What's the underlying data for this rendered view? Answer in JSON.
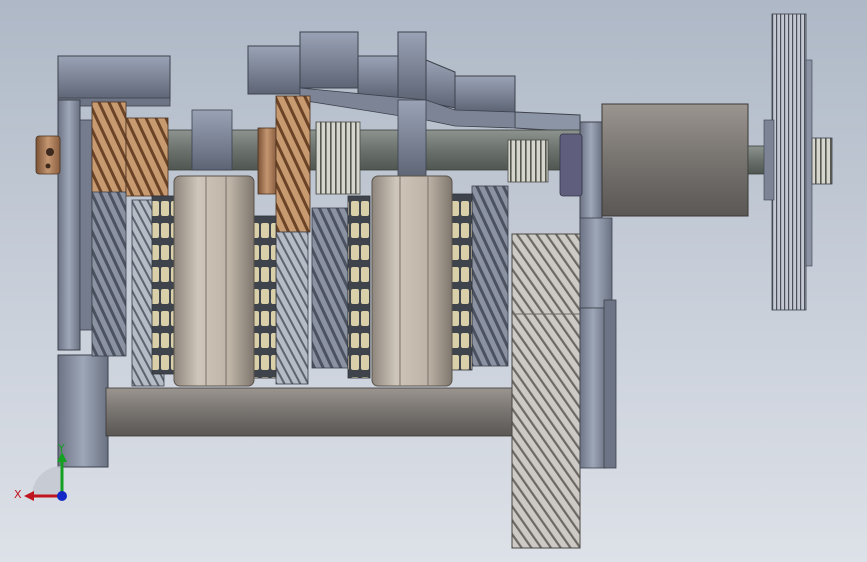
{
  "viewport": {
    "background_top": "#aeb8c6",
    "background_bottom": "#dde1e8",
    "model": "gearbox-assembly"
  },
  "triad": {
    "x_label": "X",
    "y_label": "Y",
    "x_color": "#c0141e",
    "y_color": "#14a020",
    "z_color": "#1428c8"
  },
  "colors": {
    "housing": "#8a93a6",
    "housing_dark": "#5f6675",
    "bronze": "#a87c58",
    "shaft": "#6f7570",
    "synchro": "#bdb2a6",
    "bearing": "#d8cfa8"
  }
}
